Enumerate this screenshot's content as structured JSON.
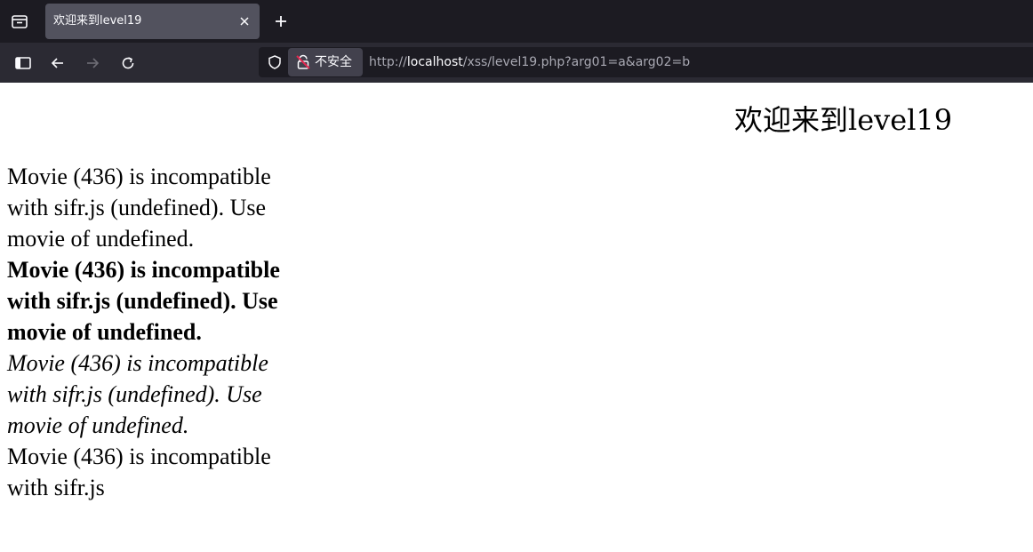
{
  "browser": {
    "tab": {
      "title": "欢迎来到level19"
    },
    "urlbar": {
      "security_label": "不安全",
      "url_prefix": "http://",
      "url_host": "localhost",
      "url_path": "/xss/level19.php?arg01=a&arg02=b"
    }
  },
  "page": {
    "heading": "欢迎来到level19",
    "flash_messages": [
      "Movie (436) is incompatible with sifr.js (undefined). Use movie of undefined.",
      "Movie (436) is incompatible with sifr.js (undefined). Use movie of undefined.",
      "Movie (436) is incompatible with sifr.js (undefined). Use movie of undefined.",
      "Movie (436) is incompatible with sifr.js"
    ]
  },
  "colors": {
    "tabbar_bg": "#1c1b22",
    "navbar_bg": "#2b2a33",
    "active_tab_bg": "#52525e",
    "insecure_lock_accent": "#e22850"
  },
  "icons": [
    "tab-list-icon",
    "close-icon",
    "plus-icon",
    "sidebar-icon",
    "back-arrow-icon",
    "forward-arrow-icon",
    "reload-icon",
    "shield-icon",
    "insecure-lock-icon"
  ]
}
